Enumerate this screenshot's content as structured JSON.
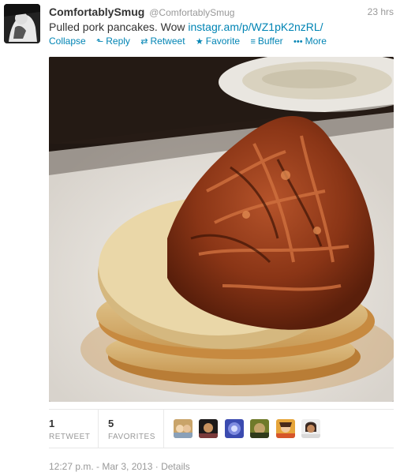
{
  "tweet": {
    "fullname": "ComfortablySmug",
    "handle": "@ComfortablySmug",
    "time": "23 hrs",
    "text": "Pulled pork pancakes. Wow ",
    "link": "instagr.am/p/WZ1pK2nzRL/"
  },
  "actions": {
    "collapse": "Collapse",
    "reply": "Reply",
    "retweet": "Retweet",
    "favorite": "Favorite",
    "buffer": "Buffer",
    "more": "More"
  },
  "icons": {
    "reply": "reply-arrow-icon",
    "retweet": "retweet-icon",
    "favorite": "star-icon",
    "buffer": "buffer-stack-icon",
    "more": "ellipsis-icon"
  },
  "stats": {
    "retweets": "1",
    "retweets_label": "RETWEET",
    "favorites": "5",
    "favorites_label": "FAVORITES"
  },
  "footer": {
    "timestamp": "12:27 p.m. - Mar 3, 2013",
    "separator": "·",
    "details": "Details"
  },
  "colors": {
    "link": "#0084b4",
    "muted": "#999999",
    "text": "#333333"
  }
}
